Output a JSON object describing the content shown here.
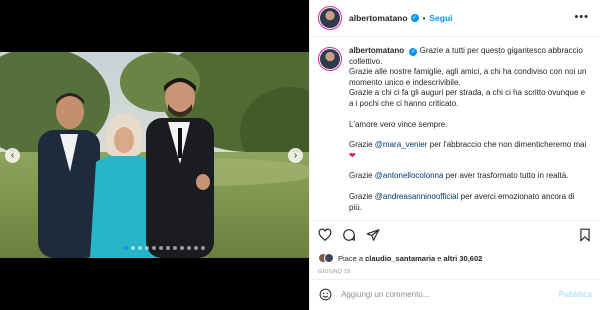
{
  "post": {
    "username": "albertomatano",
    "verified_mark": "✓",
    "separator": "•",
    "follow_label": "Segui",
    "more_label": "•••"
  },
  "media": {
    "prev_arrow": "‹",
    "next_arrow": "›",
    "carousel_dots": 12,
    "active_dot": 0
  },
  "caption": {
    "username": "albertomatano",
    "line1": "Grazie a tutti per questo gigantesco abbraccio collettivo.",
    "line2": "Grazie alle nostre famiglie, agli amici, a chi ha condiviso con noi un momento unico e indescrivibile.",
    "line3": "Grazie a chi ci fa gli auguri per strada, a chi ci ha scritto ovunque e a i pochi che ci hanno criticato.",
    "line4": "L'amore vero vince sempre.",
    "thanks_prefix": "Grazie",
    "mention1": "@mara_venier",
    "mention1_text": "per l'abbraccio che non dimenticheremo mai",
    "heart": "❤",
    "mention2": "@antonellocolonna",
    "mention2_text": "per aver trasformato tutto in realtà.",
    "mention3": "@andreasanninoofficial",
    "mention3_text": "per averci emozionato ancora di più."
  },
  "actions": {
    "icons": [
      "heart-icon",
      "comment-icon",
      "share-icon",
      "bookmark-icon"
    ]
  },
  "likes": {
    "prefix": "Piace a",
    "user": "claudio_santamaria",
    "conjunction": "e",
    "others": "altri 30,602"
  },
  "date": "GIUGNO 15",
  "comment": {
    "placeholder": "Aggiungi un commento...",
    "publish_label": "Pubblica"
  },
  "colors": {
    "accent": "#0095f6",
    "mention": "#00376b",
    "heart": "#e0245e",
    "publish_disabled": "#b2dffc"
  }
}
